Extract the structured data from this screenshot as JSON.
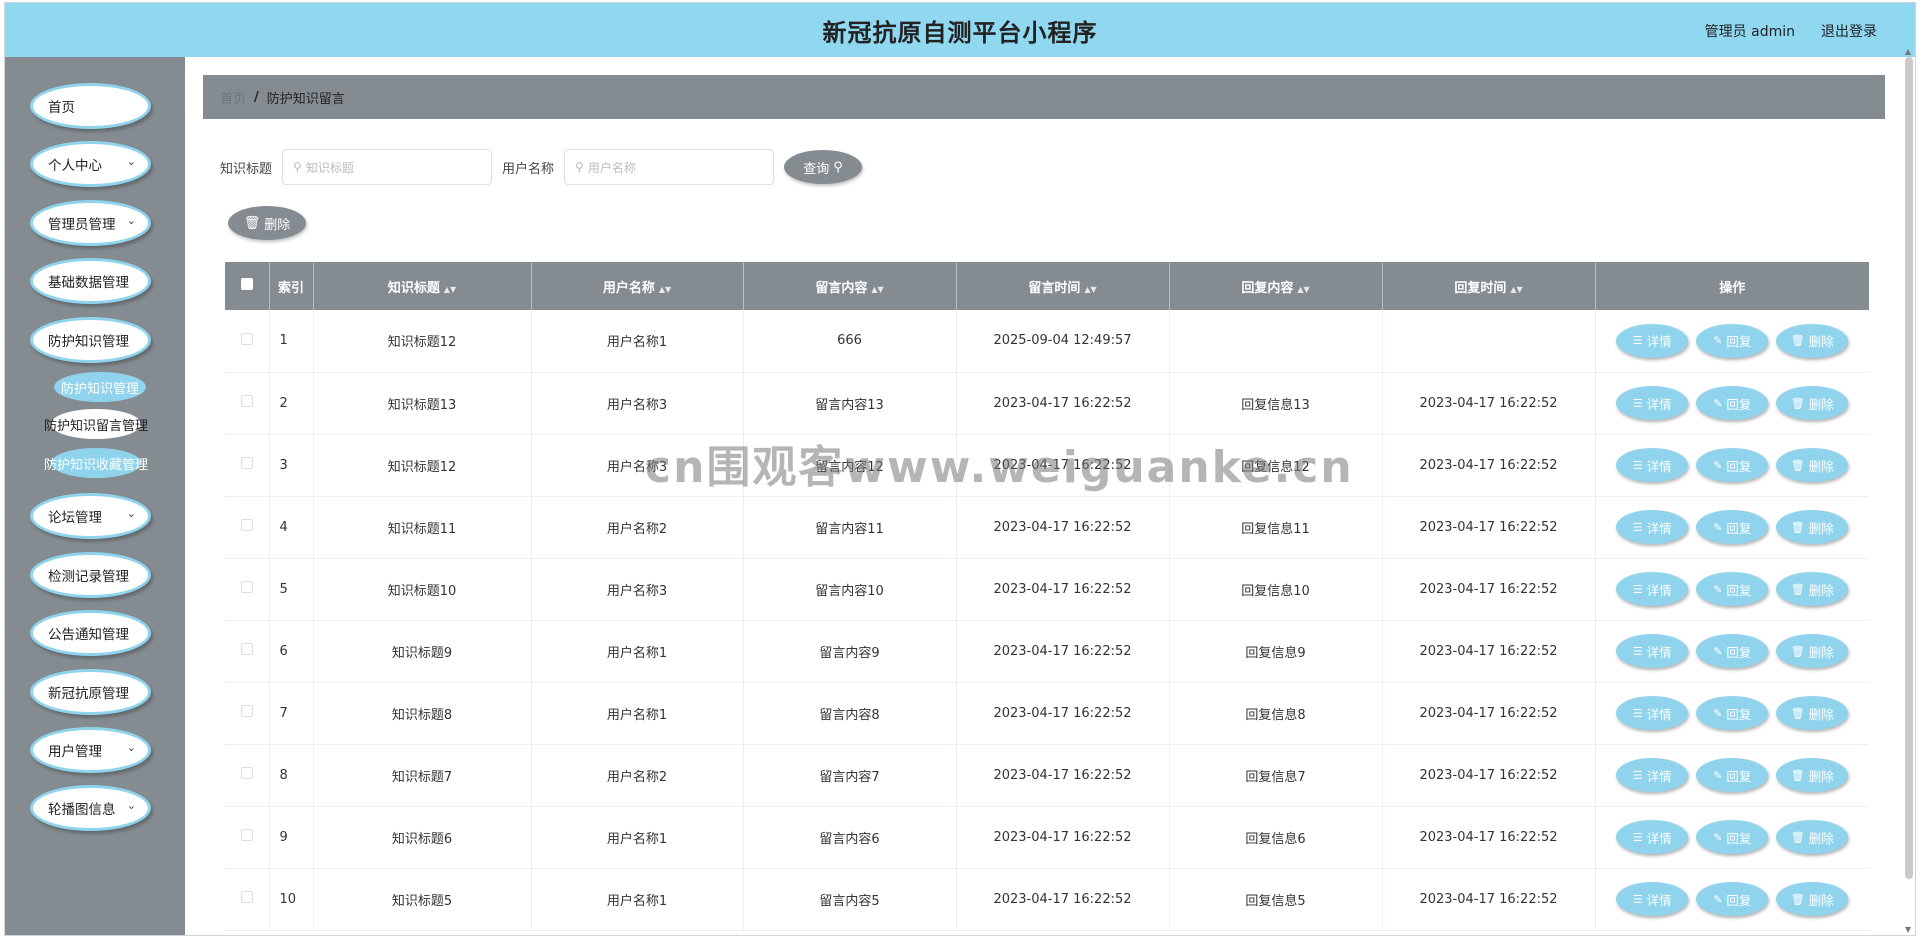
{
  "header": {
    "title": "新冠抗原自测平台小程序",
    "user": "管理员 admin",
    "logout": "退出登录"
  },
  "sidebar": {
    "items": [
      {
        "label": "首页",
        "chevron": false
      },
      {
        "label": "个人中心",
        "chevron": true
      },
      {
        "label": "管理员管理",
        "chevron": true
      },
      {
        "label": "基础数据管理",
        "chevron": false
      },
      {
        "label": "防护知识管理",
        "chevron": false
      },
      {
        "label": "论坛管理",
        "chevron": true
      },
      {
        "label": "检测记录管理",
        "chevron": false
      },
      {
        "label": "公告通知管理",
        "chevron": false
      },
      {
        "label": "新冠抗原管理",
        "chevron": false
      },
      {
        "label": "用户管理",
        "chevron": true
      },
      {
        "label": "轮播图信息",
        "chevron": true
      }
    ],
    "submenu": [
      "防护知识管理",
      "防护知识留言管理",
      "防护知识收藏管理"
    ]
  },
  "breadcrumb": {
    "home": "首页",
    "separator": "/",
    "current": "防护知识留言"
  },
  "search": {
    "title_label": "知识标题",
    "title_placeholder": "知识标题",
    "user_label": "用户名称",
    "user_placeholder": "用户名称",
    "search_button": "查询",
    "delete_button": "删除"
  },
  "table": {
    "headers": [
      "索引",
      "知识标题",
      "用户名称",
      "留言内容",
      "留言时间",
      "回复内容",
      "回复时间",
      "操作"
    ],
    "actions": {
      "detail": "详情",
      "reply": "回复",
      "delete": "删除"
    },
    "rows": [
      {
        "index": "1",
        "title": "知识标题12",
        "user": "用户名称1",
        "content": "666",
        "time": "2025-09-04 12:49:57",
        "reply": "",
        "reply_time": ""
      },
      {
        "index": "2",
        "title": "知识标题13",
        "user": "用户名称3",
        "content": "留言内容13",
        "time": "2023-04-17 16:22:52",
        "reply": "回复信息13",
        "reply_time": "2023-04-17 16:22:52"
      },
      {
        "index": "3",
        "title": "知识标题12",
        "user": "用户名称3",
        "content": "留言内容12",
        "time": "2023-04-17 16:22:52",
        "reply": "回复信息12",
        "reply_time": "2023-04-17 16:22:52"
      },
      {
        "index": "4",
        "title": "知识标题11",
        "user": "用户名称2",
        "content": "留言内容11",
        "time": "2023-04-17 16:22:52",
        "reply": "回复信息11",
        "reply_time": "2023-04-17 16:22:52"
      },
      {
        "index": "5",
        "title": "知识标题10",
        "user": "用户名称3",
        "content": "留言内容10",
        "time": "2023-04-17 16:22:52",
        "reply": "回复信息10",
        "reply_time": "2023-04-17 16:22:52"
      },
      {
        "index": "6",
        "title": "知识标题9",
        "user": "用户名称1",
        "content": "留言内容9",
        "time": "2023-04-17 16:22:52",
        "reply": "回复信息9",
        "reply_time": "2023-04-17 16:22:52"
      },
      {
        "index": "7",
        "title": "知识标题8",
        "user": "用户名称1",
        "content": "留言内容8",
        "time": "2023-04-17 16:22:52",
        "reply": "回复信息8",
        "reply_time": "2023-04-17 16:22:52"
      },
      {
        "index": "8",
        "title": "知识标题7",
        "user": "用户名称2",
        "content": "留言内容7",
        "time": "2023-04-17 16:22:52",
        "reply": "回复信息7",
        "reply_time": "2023-04-17 16:22:52"
      },
      {
        "index": "9",
        "title": "知识标题6",
        "user": "用户名称1",
        "content": "留言内容6",
        "time": "2023-04-17 16:22:52",
        "reply": "回复信息6",
        "reply_time": "2023-04-17 16:22:52"
      },
      {
        "index": "10",
        "title": "知识标题5",
        "user": "用户名称1",
        "content": "留言内容5",
        "time": "2023-04-17 16:22:52",
        "reply": "回复信息5",
        "reply_time": "2023-04-17 16:22:52"
      }
    ]
  },
  "watermark": "cn围观客www.weiguanke.cn",
  "colors": {
    "header": "#90d7f0",
    "sidebar": "#858c91",
    "accent": "#8fd4ec",
    "table_head": "#858c91"
  }
}
